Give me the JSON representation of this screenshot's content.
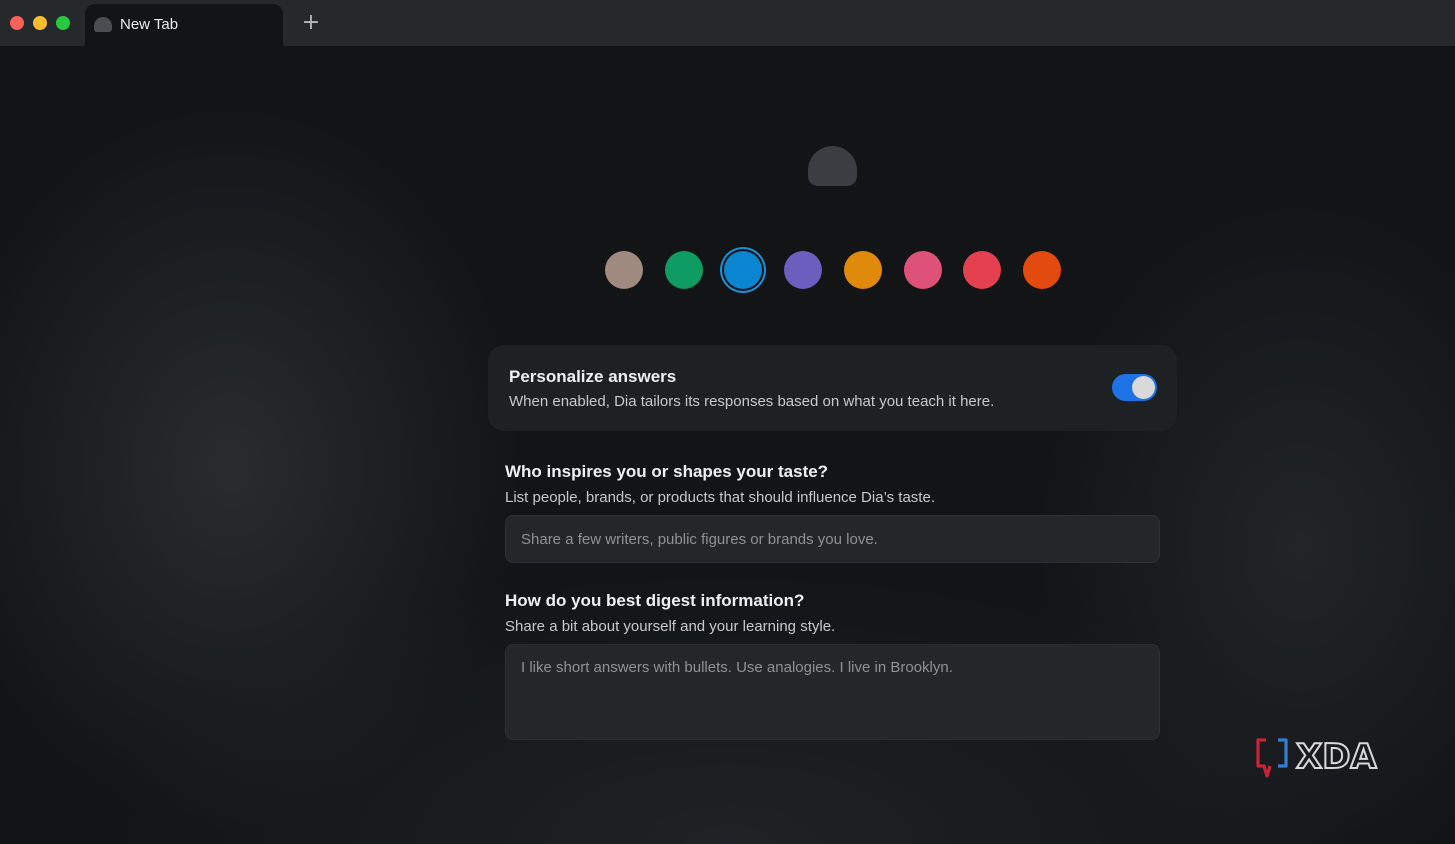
{
  "tab": {
    "title": "New Tab",
    "new_tab_symbol": "+"
  },
  "icons": {
    "tab_favicon": "dia-dome-icon",
    "back": "chevron-left-icon",
    "forward": "chevron-right-icon",
    "reload": "reload-icon",
    "profile": "dia-dome-icon"
  },
  "colors": {
    "swatches": [
      "#a08a7f",
      "#0e9c62",
      "#0a86d0",
      "#6a5fbf",
      "#e08a0c",
      "#de5277",
      "#e5404f",
      "#e34a10"
    ],
    "selected_index": 2,
    "toggle_on": "#1e72e6"
  },
  "personalize": {
    "title": "Personalize answers",
    "description": "When enabled, Dia tailors its responses based on what you teach it here.",
    "enabled": true
  },
  "taste": {
    "title": "Who inspires you or shapes your taste?",
    "description": "List people, brands, or products that should influence Dia’s taste.",
    "placeholder": "Share a few writers, public figures or brands you love."
  },
  "digest": {
    "title": "How do you best digest information?",
    "description": "Share a bit about yourself and your learning style.",
    "placeholder": "I like short answers with bullets. Use analogies. I live in Brooklyn."
  },
  "watermark": {
    "text": "XDA"
  }
}
